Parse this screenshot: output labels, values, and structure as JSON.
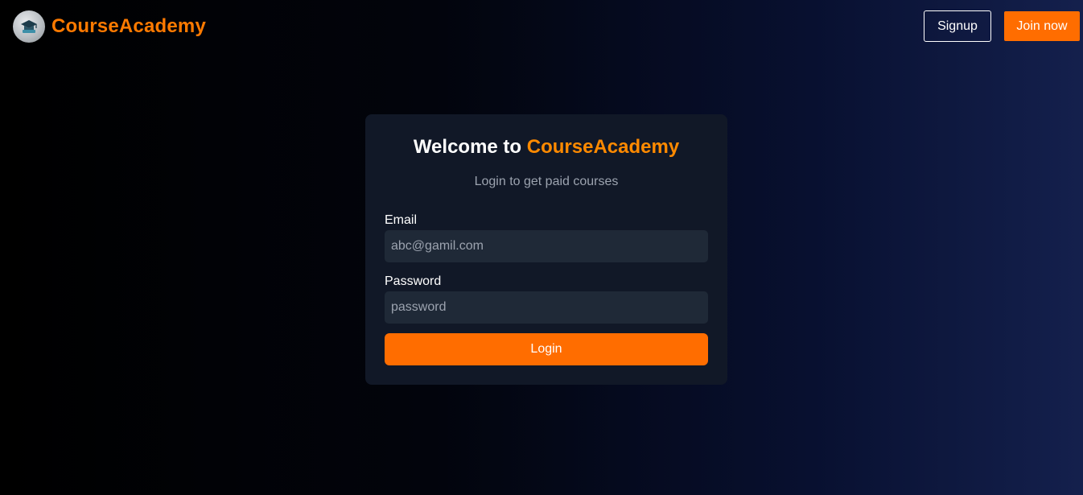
{
  "header": {
    "logo_icon": "graduation-cap-icon",
    "brand": "CourseAcademy",
    "signup_label": "Signup",
    "join_label": "Join now"
  },
  "login_card": {
    "title_prefix": "Welcome to ",
    "title_brand": "CourseAcademy",
    "subtitle": "Login to get paid courses",
    "email_label": "Email",
    "email_placeholder": "abc@gamil.com",
    "password_label": "Password",
    "password_placeholder": "password",
    "login_label": "Login"
  },
  "colors": {
    "accent": "#ff6d00",
    "card_bg": "#111827",
    "input_bg": "#1f2937",
    "muted_text": "#9ca3af"
  }
}
